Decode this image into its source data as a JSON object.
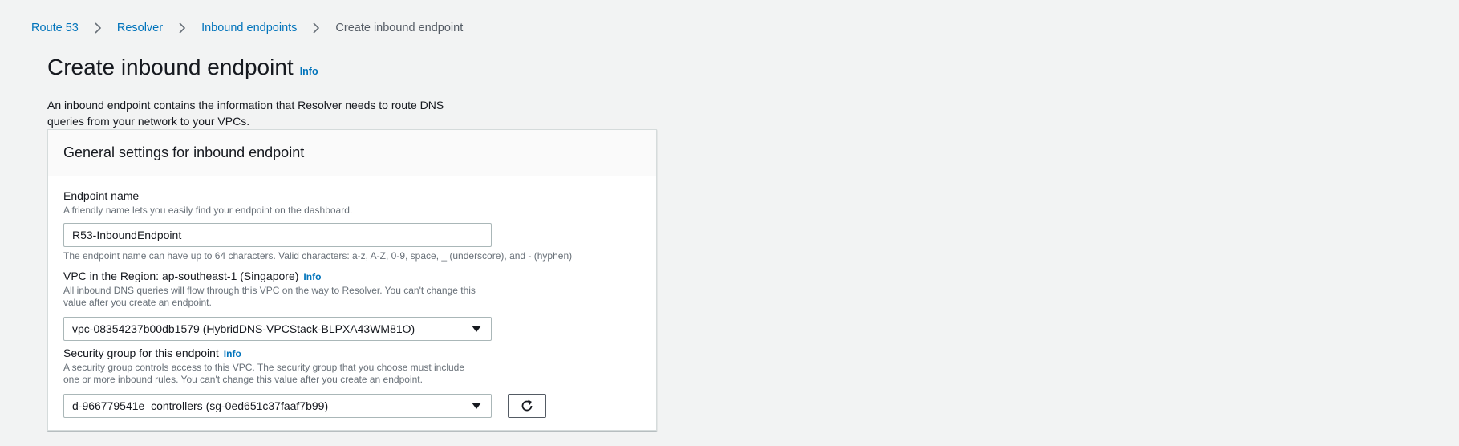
{
  "breadcrumb": {
    "items": [
      "Route 53",
      "Resolver",
      "Inbound endpoints"
    ],
    "current": "Create inbound endpoint"
  },
  "page": {
    "title": "Create inbound endpoint",
    "info": "Info",
    "description": "An inbound endpoint contains the information that Resolver needs to route DNS queries from your network to your VPCs."
  },
  "card": {
    "header": "General settings for inbound endpoint"
  },
  "endpoint_name": {
    "label": "Endpoint name",
    "description": "A friendly name lets you easily find your endpoint on the dashboard.",
    "value": "R53-InboundEndpoint",
    "constraint": "The endpoint name can have up to 64 characters. Valid characters: a-z, A-Z, 0-9, space, _ (underscore), and - (hyphen)"
  },
  "vpc": {
    "label": "VPC in the Region: ap-southeast-1 (Singapore)",
    "info": "Info",
    "description": "All inbound DNS queries will flow through this VPC on the way to Resolver. You can't change this value after you create an endpoint.",
    "selected": "vpc-08354237b00db1579 (HybridDNS-VPCStack-BLPXA43WM81O)"
  },
  "security_group": {
    "label": "Security group for this endpoint",
    "info": "Info",
    "description": "A security group controls access to this VPC. The security group that you choose must include one or more inbound rules. You can't change this value after you create an endpoint.",
    "selected": "d-966779541e_controllers (sg-0ed651c37faaf7b99)"
  },
  "icons": {
    "breadcrumb_separator": "chevron-right-icon",
    "dropdown": "caret-down-icon",
    "refresh": "refresh-icon"
  },
  "colors": {
    "link": "#0073bb",
    "background": "#f2f3f3",
    "text": "#16191f",
    "muted": "#687078"
  }
}
